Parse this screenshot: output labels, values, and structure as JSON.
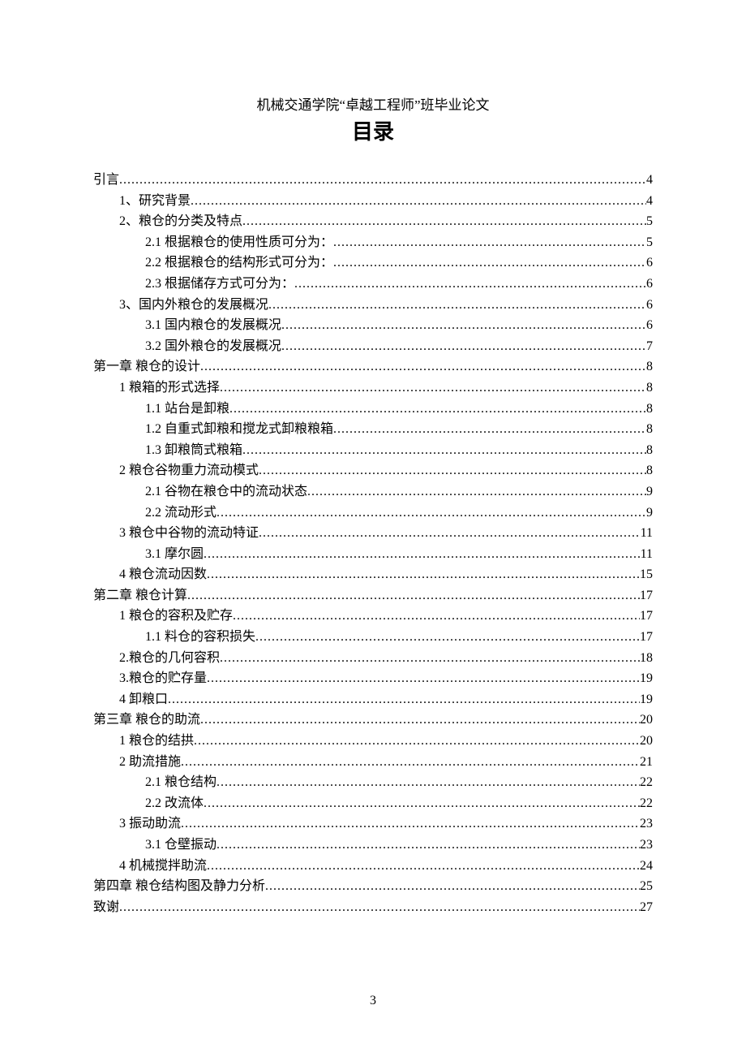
{
  "header": "机械交通学院“卓越工程师”班毕业论文",
  "title": "目录",
  "page_number": "3",
  "toc": [
    {
      "label": "引言",
      "page": "4",
      "level": 0
    },
    {
      "label": "1、研究背景 ",
      "page": "4",
      "level": 1
    },
    {
      "label": "2、粮仓的分类及特点 ",
      "page": "5",
      "level": 1
    },
    {
      "label": "2.1 根据粮仓的使用性质可分为： ",
      "page": "5",
      "level": 2
    },
    {
      "label": "2.2 根据粮仓的结构形式可分为： ",
      "page": "6",
      "level": 2
    },
    {
      "label": "2.3 根据储存方式可分为： ",
      "page": "6",
      "level": 2
    },
    {
      "label": "3、国内外粮仓的发展概况 ",
      "page": "6",
      "level": 1
    },
    {
      "label": "3.1 国内粮仓的发展概况 ",
      "page": "6",
      "level": 2
    },
    {
      "label": "3.2 国外粮仓的发展概况 ",
      "page": "7",
      "level": 2
    },
    {
      "label": "第一章 粮仓的设计",
      "page": "8",
      "level": 0
    },
    {
      "label": "1 粮箱的形式选择",
      "page": "8",
      "level": 1
    },
    {
      "label": "1.1 站台是卸粮 ",
      "page": "8",
      "level": 2
    },
    {
      "label": "1.2 自重式卸粮和搅龙式卸粮粮箱 ",
      "page": "8",
      "level": 2
    },
    {
      "label": "1.3 卸粮筒式粮箱 ",
      "page": "8",
      "level": 2
    },
    {
      "label": "2 粮仓谷物重力流动模式",
      "page": "8",
      "level": 1
    },
    {
      "label": "2.1 谷物在粮仓中的流动状态 ",
      "page": "9",
      "level": 2
    },
    {
      "label": "2.2 流动形式 ",
      "page": "9",
      "level": 2
    },
    {
      "label": "3 粮仓中谷物的流动特证 ",
      "page": "11",
      "level": 1
    },
    {
      "label": "3.1 摩尔圆",
      "page": " 11",
      "level": 2
    },
    {
      "label": "4 粮仓流动因数 ",
      "page": "15",
      "level": 1
    },
    {
      "label": "第二章 粮仓计算",
      "page": "17",
      "level": 0
    },
    {
      "label": "1 粮仓的容积及贮存",
      "page": "17",
      "level": 1
    },
    {
      "label": "1.1 料仓的容积损失 ",
      "page": "17",
      "level": 2
    },
    {
      "label": "2.粮仓的几何容积 ",
      "page": "18",
      "level": 1
    },
    {
      "label": "3.粮仓的贮存量 ",
      "page": "19",
      "level": 1
    },
    {
      "label": "4 卸粮口",
      "page": "19",
      "level": 1
    },
    {
      "label": "第三章 粮仓的助流",
      "page": "20",
      "level": 0
    },
    {
      "label": "1 粮仓的结拱",
      "page": "20",
      "level": 1
    },
    {
      "label": "2 助流措施",
      "page": "21",
      "level": 1
    },
    {
      "label": "2.1 粮仓结构 ",
      "page": "22",
      "level": 2
    },
    {
      "label": "2.2 改流体 ",
      "page": "22",
      "level": 2
    },
    {
      "label": "3 振动助流",
      "page": "23",
      "level": 1
    },
    {
      "label": "3.1 仓壁振动 ",
      "page": "23",
      "level": 2
    },
    {
      "label": "4 机械搅拌助流",
      "page": "24",
      "level": 1
    },
    {
      "label": "第四章 粮仓结构图及静力分析",
      "page": "25",
      "level": 0
    },
    {
      "label": "致谢",
      "page": "27",
      "level": 0
    }
  ]
}
